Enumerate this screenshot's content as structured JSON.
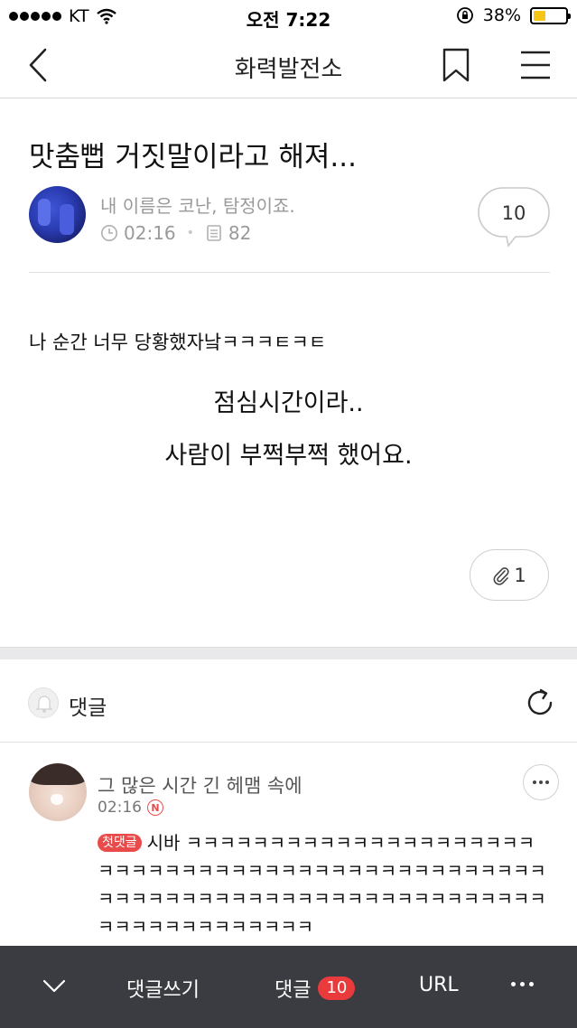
{
  "status_bar": {
    "carrier": "KT",
    "time": "오전 7:22",
    "battery": "38%",
    "battery_level": 0.38,
    "battery_color": "#f5c518"
  },
  "nav": {
    "title": "화력발전소",
    "icons": [
      "back-chevron-icon",
      "bookmark-icon",
      "menu-icon"
    ]
  },
  "post": {
    "title": "맛춤뻡 거짓말이라고 해져...",
    "author": "내 이름은 코난, 탐정이죠.",
    "time": "02:16",
    "views": "82",
    "comment_count": "10",
    "body_line1": "나 순간 너무 당황했자낰ㅋㅋㅋㅌㅋㅌ",
    "body_line2": "점심시간이라..",
    "body_line3": "사람이 부쩍부쩍 했어요.",
    "attachments": "1"
  },
  "comments_section": {
    "label": "댓글"
  },
  "comment": {
    "author": "그 많은 시간 긴 헤맴 속에",
    "time": "02:16",
    "new_badge": "N",
    "first_badge": "첫댓글",
    "text": "시바 ㅋㅋㅋㅋㅋㅋㅋㅋㅋㅋㅋㅋㅋㅋㅋㅋㅋㅋㅋㅋㅋㅋㅋㅋㅋㅋㅋㅋㅋㅋㅋㅋㅋㅋㅋㅋㅋㅋㅋㅋㅋㅋㅋㅋㅋㅋㅋㅋㅋㅋㅋㅋㅋㅋㅋㅋㅋㅋㅋㅋㅋㅋㅋㅋㅋㅋㅋㅋㅋㅋㅋㅋㅋㅋㅋㅋㅋㅋㅋㅋㅋㅋㅋㅋㅋㅋㅋㅋ"
  },
  "bottom_bar": {
    "write_comment": "댓글쓰기",
    "comments": "댓글",
    "comments_count": "10",
    "url": "URL",
    "accent": "#e93b3b"
  }
}
